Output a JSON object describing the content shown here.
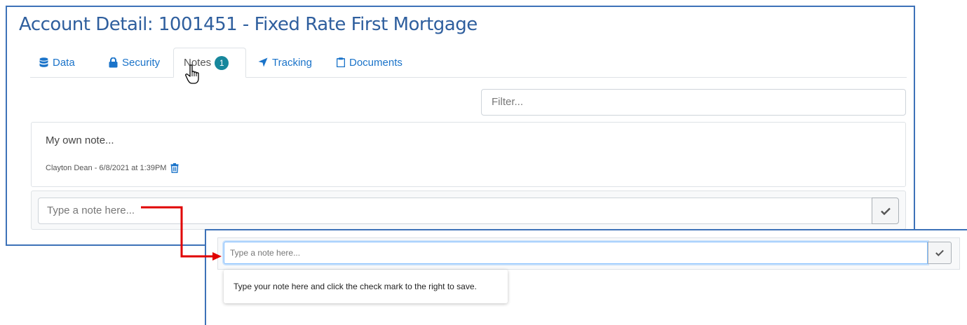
{
  "title": "Account Detail: 1001451 - Fixed Rate First Mortgage",
  "tabs": [
    {
      "label": "Data",
      "icon": "database-icon"
    },
    {
      "label": "Security",
      "icon": "lock-icon"
    },
    {
      "label": "Notes",
      "icon": "",
      "badge": "1",
      "active": true
    },
    {
      "label": "Tracking",
      "icon": "location-arrow-icon"
    },
    {
      "label": "Documents",
      "icon": "clipboard-icon"
    }
  ],
  "filter": {
    "placeholder": "Filter..."
  },
  "note": {
    "text": "My own note...",
    "meta": "Clayton Dean - 6/8/2021 at 1:39PM"
  },
  "note_input": {
    "placeholder": "Type a note here..."
  },
  "zoom": {
    "placeholder": "Type a note here...",
    "tooltip": "Type your note here and click the check mark to the right to save."
  },
  "colors": {
    "accent": "#1a73c9",
    "title": "#2f5f9e",
    "badge": "#17879c",
    "callout_border": "#3d72b8",
    "arrow": "#e00000"
  }
}
